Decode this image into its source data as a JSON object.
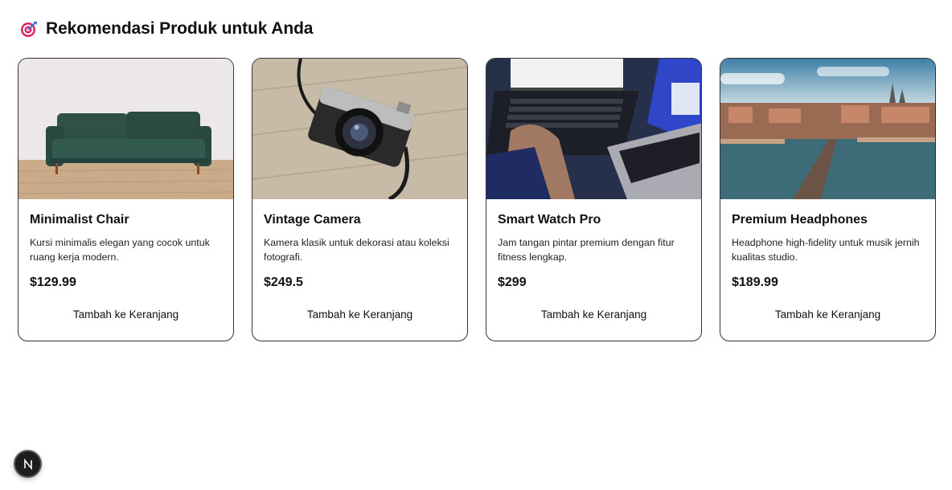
{
  "header": {
    "icon": "target-icon",
    "title": "Rekomendasi Produk untuk Anda"
  },
  "products": [
    {
      "image": "sofa-photo",
      "name": "Minimalist Chair",
      "description": "Kursi minimalis elegan yang cocok untuk ruang kerja modern.",
      "price": "$129.99",
      "button_label": "Tambah ke Keranjang"
    },
    {
      "image": "camera-photo",
      "name": "Vintage Camera",
      "description": "Kamera klasik untuk dekorasi atau koleksi fotografi.",
      "price": "$249.5",
      "button_label": "Tambah ke Keranjang"
    },
    {
      "image": "laptop-photo",
      "name": "Smart Watch Pro",
      "description": "Jam tangan pintar premium dengan fitur fitness lengkap.",
      "price": "$299",
      "button_label": "Tambah ke Keranjang"
    },
    {
      "image": "city-photo",
      "name": "Premium Headphones",
      "description": "Headphone high-fidelity untuk musik jernih kualitas studio.",
      "price": "$189.99",
      "button_label": "Tambah ke Keranjang"
    }
  ],
  "dev_badge": {
    "icon": "nextjs-logo-icon",
    "letter": "N"
  },
  "colors": {
    "card_border": "#333333",
    "text": "#111111",
    "badge_bg": "#1d1d1d"
  }
}
